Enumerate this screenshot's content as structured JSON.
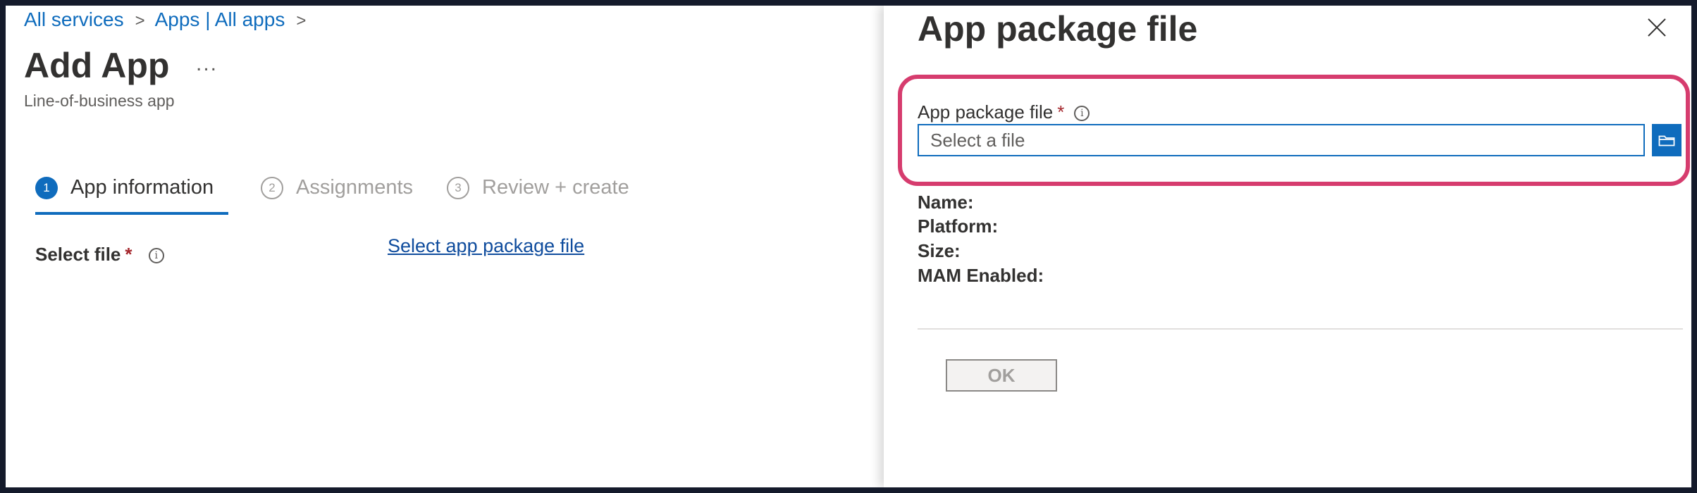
{
  "breadcrumb": {
    "items": [
      {
        "label": "All services"
      },
      {
        "label": "Apps | All apps"
      }
    ],
    "separator": ">"
  },
  "page": {
    "title": "Add App",
    "more_label": "...",
    "subtitle": "Line-of-business app"
  },
  "steps": [
    {
      "number": "1",
      "label": "App information",
      "active": true
    },
    {
      "number": "2",
      "label": "Assignments",
      "active": false
    },
    {
      "number": "3",
      "label": "Review + create",
      "active": false
    }
  ],
  "form": {
    "select_file_label": "Select file",
    "required_mark": "*",
    "info_glyph": "i",
    "select_link": "Select app package file"
  },
  "panel": {
    "title": "App package file",
    "close_icon": "close-icon",
    "field_label": "App package file",
    "required_mark": "*",
    "info_glyph": "i",
    "input_placeholder": "Select a file",
    "input_value": "",
    "browse_icon": "folder-icon",
    "details": {
      "name_label": "Name:",
      "platform_label": "Platform:",
      "size_label": "Size:",
      "mam_label": "MAM Enabled:"
    },
    "ok_label": "OK"
  },
  "colors": {
    "accent": "#0f6cbd",
    "link": "#0f4c9d",
    "required": "#a4262c",
    "highlight": "#d63c6e",
    "outer_frame": "#141a2b"
  }
}
